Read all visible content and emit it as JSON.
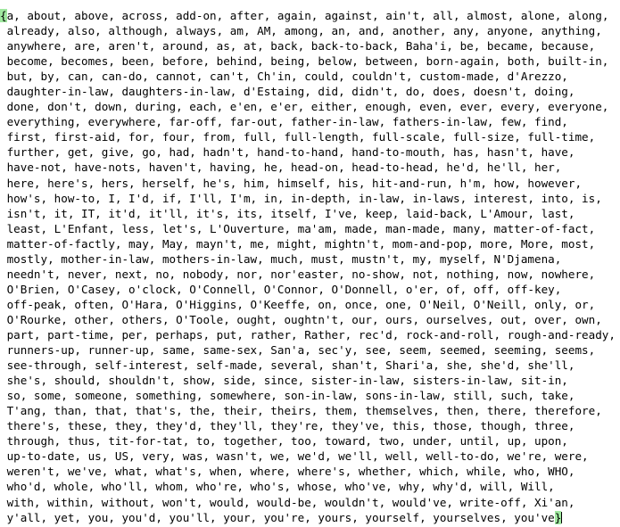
{
  "editor": {
    "language_construct": "set-literal",
    "open_brace": "{",
    "close_brace": "}",
    "brace_highlight_color": "#9fe89f",
    "text_color": "#000000",
    "background_color": "#ffffff",
    "caret_visible": true,
    "lines": [
      "a, about, above, across, add-on, after, again, against, ain't, all, almost, alone, along,",
      " already, also, although, always, am, AM, among, an, and, another, any, anyone, anything,",
      " anywhere, are, aren't, around, as, at, back, back-to-back, Baha'i, be, became, because,",
      " become, becomes, been, before, behind, being, below, between, born-again, both, built-in,",
      " but, by, can, can-do, cannot, can't, Ch'in, could, couldn't, custom-made, d'Arezzo,",
      " daughter-in-law, daughters-in-law, d'Estaing, did, didn't, do, does, doesn't, doing,",
      " done, don't, down, during, each, e'en, e'er, either, enough, even, ever, every, everyone,",
      " everything, everywhere, far-off, far-out, father-in-law, fathers-in-law, few, find,",
      " first, first-aid, for, four, from, full, full-length, full-scale, full-size, full-time,",
      " further, get, give, go, had, hadn't, hand-to-hand, hand-to-mouth, has, hasn't, have,",
      " have-not, have-nots, haven't, having, he, head-on, head-to-head, he'd, he'll, her,",
      " here, here's, hers, herself, he's, him, himself, his, hit-and-run, h'm, how, however,",
      " how's, how-to, I, I'd, if, I'll, I'm, in, in-depth, in-law, in-laws, interest, into, is,",
      " isn't, it, IT, it'd, it'll, it's, its, itself, I've, keep, laid-back, L'Amour, last,",
      " least, L'Enfant, less, let's, L'Ouverture, ma'am, made, man-made, many, matter-of-fact,",
      " matter-of-factly, may, May, mayn't, me, might, mightn't, mom-and-pop, more, More, most,",
      " mostly, mother-in-law, mothers-in-law, much, must, mustn't, my, myself, N'Djamena,",
      " needn't, never, next, no, nobody, nor, nor'easter, no-show, not, nothing, now, nowhere,",
      " O'Brien, O'Casey, o'clock, O'Connell, O'Connor, O'Donnell, o'er, of, off, off-key,",
      " off-peak, often, O'Hara, O'Higgins, O'Keeffe, on, once, one, O'Neil, O'Neill, only, or,",
      " O'Rourke, other, others, O'Toole, ought, oughtn't, our, ours, ourselves, out, over, own,",
      " part, part-time, per, perhaps, put, rather, Rather, rec'd, rock-and-roll, rough-and-ready,",
      " runners-up, runner-up, same, same-sex, San'a, sec'y, see, seem, seemed, seeming, seems,",
      " see-through, self-interest, self-made, several, shan't, Shari'a, she, she'd, she'll,",
      " she's, should, shouldn't, show, side, since, sister-in-law, sisters-in-law, sit-in,",
      " so, some, someone, something, somewhere, son-in-law, sons-in-law, still, such, take,",
      " T'ang, than, that, that's, the, their, theirs, them, themselves, then, there, therefore,",
      " there's, these, they, they'd, they'll, they're, they've, this, those, though, three,",
      " through, thus, tit-for-tat, to, together, too, toward, two, under, until, up, upon,",
      " up-to-date, us, US, very, was, wasn't, we, we'd, we'll, well, well-to-do, we're, were,",
      " weren't, we've, what, what's, when, where, where's, whether, which, while, who, WHO,",
      " who'd, whole, who'll, whom, who're, who's, whose, who've, why, why'd, will, Will,",
      " with, within, without, won't, would, would-be, wouldn't, would've, write-off, Xi'an,",
      " y'all, yet, you, you'd, you'll, your, you're, yours, yourself, yourselves, you've"
    ]
  }
}
